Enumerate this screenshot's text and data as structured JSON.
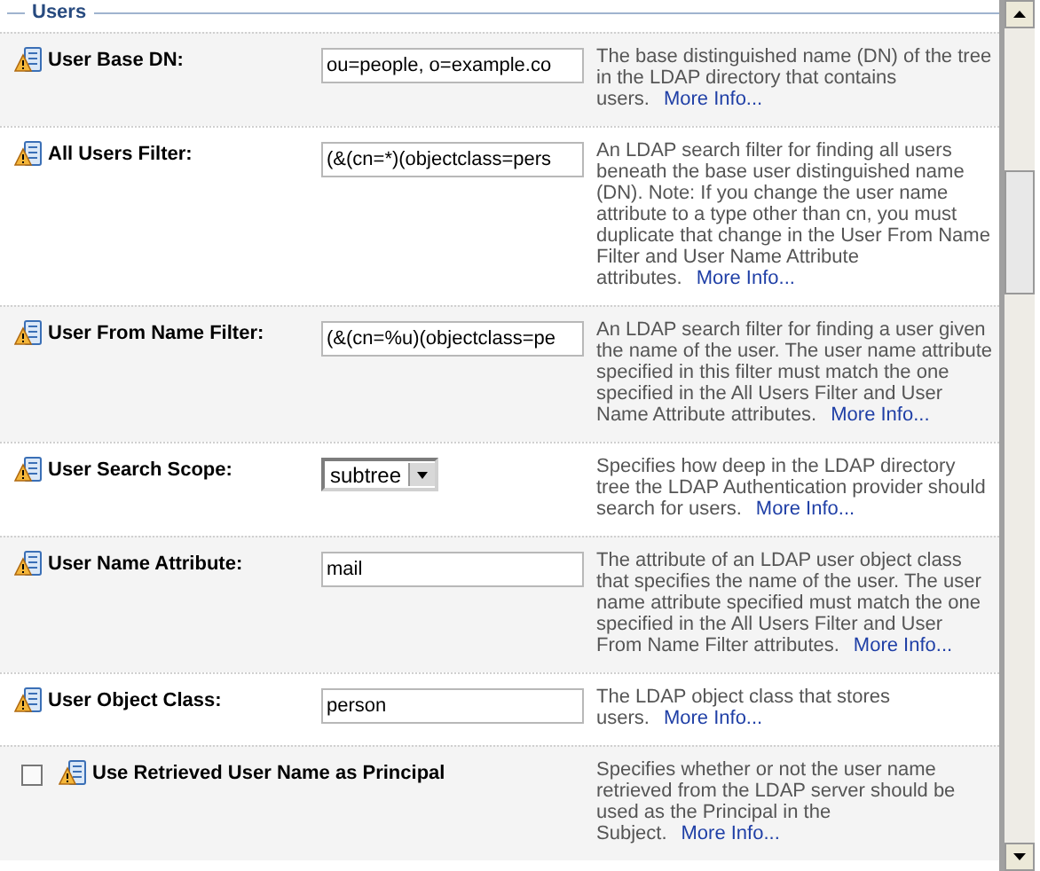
{
  "section": {
    "title": "Users"
  },
  "rows": [
    {
      "kind": "text",
      "label": "User Base DN:",
      "value": "ou=people, o=example.co",
      "description": "The base distinguished name (DN) of the tree in the LDAP directory that contains users.",
      "link": "More Info..."
    },
    {
      "kind": "text",
      "label": "All Users Filter:",
      "value": "(&(cn=*)(objectclass=pers",
      "description": "An LDAP search filter for finding all users beneath the base user distinguished name (DN). Note: If you change the user name attribute to a type other than cn, you must duplicate that change in the User From Name Filter and User Name Attribute attributes.",
      "link": "More Info..."
    },
    {
      "kind": "text",
      "label": "User From Name Filter:",
      "value": "(&(cn=%u)(objectclass=pe",
      "description": "An LDAP search filter for finding a user given the name of the user. The user name attribute specified in this filter must match the one specified in the All Users Filter and User Name Attribute attributes.",
      "link": "More Info..."
    },
    {
      "kind": "select",
      "label": "User Search Scope:",
      "value": "subtree",
      "description": "Specifies how deep in the LDAP directory tree the LDAP Authentication provider should search for users.",
      "link": "More Info..."
    },
    {
      "kind": "text",
      "label": "User Name Attribute:",
      "value": "mail",
      "description": "The attribute of an LDAP user object class that specifies the name of the user. The user name attribute specified must match the one specified in the All Users Filter and User From Name Filter attributes.",
      "link": "More Info..."
    },
    {
      "kind": "text",
      "label": "User Object Class:",
      "value": "person",
      "description": "The LDAP object class that stores users.",
      "link": "More Info..."
    },
    {
      "kind": "checkbox",
      "label": "Use Retrieved User Name as Principal",
      "checked": false,
      "description": "Specifies whether or not the user name retrieved from the LDAP server should be used as the Principal in the Subject.",
      "link": "More Info..."
    }
  ]
}
